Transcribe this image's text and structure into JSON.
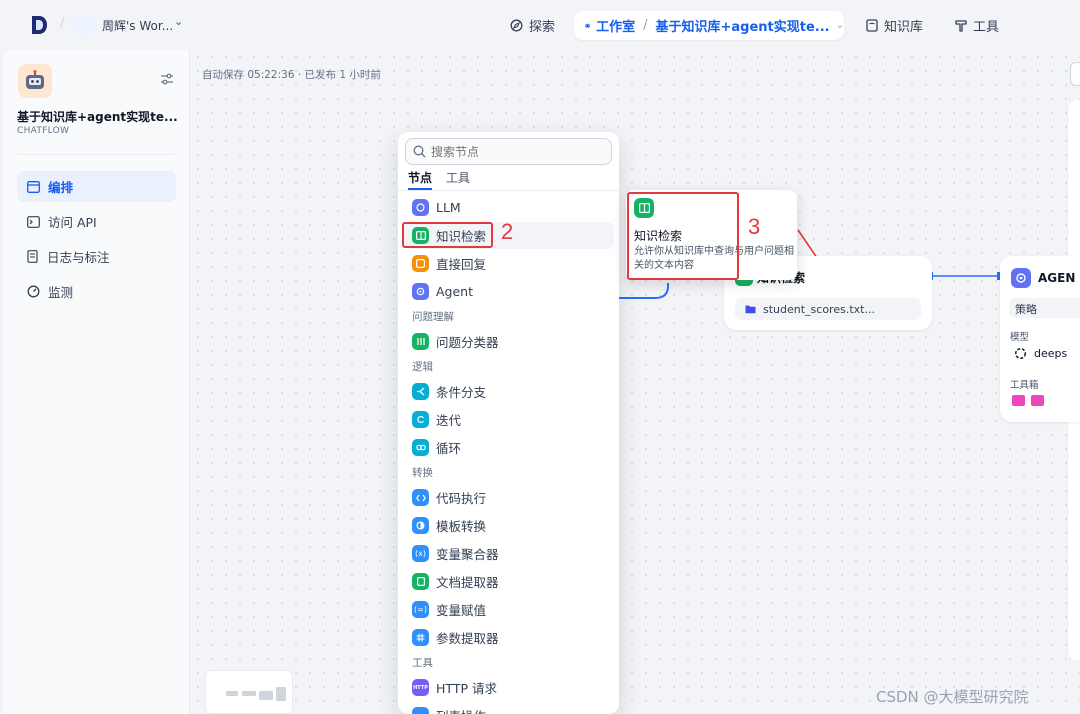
{
  "topbar": {
    "workspace_name": "周辉's Wor...",
    "nav": {
      "explore": "探索",
      "studio": "工作室",
      "app_name": "基于知识库+agent实现te...",
      "knowledge": "知识库",
      "tools": "工具"
    }
  },
  "sidebar": {
    "app_title": "基于知识库+agent实现te...",
    "app_type": "CHATFLOW",
    "items": [
      {
        "label": "编排",
        "icon": "layout-icon",
        "active": true
      },
      {
        "label": "访问 API",
        "icon": "terminal-icon",
        "active": false
      },
      {
        "label": "日志与标注",
        "icon": "document-icon",
        "active": false
      },
      {
        "label": "监测",
        "icon": "gauge-icon",
        "active": false
      }
    ]
  },
  "canvas": {
    "autosave": "自动保存 05:22:36 · 已发布 1 小时前",
    "kb_node": {
      "title": "知识检索",
      "file": "student_scores.txt..."
    },
    "agent_node": {
      "title": "AGEN",
      "strategy": "策略",
      "model_label": "模型",
      "model": "deeps",
      "toolbox_label": "工具箱"
    }
  },
  "picker": {
    "search_placeholder": "搜索节点",
    "tabs": [
      "节点",
      "工具"
    ],
    "items_top": [
      {
        "label": "LLM",
        "color": "#6172f3"
      },
      {
        "label": "知识检索",
        "color": "#16b364"
      },
      {
        "label": "直接回复",
        "color": "#f79009"
      },
      {
        "label": "Agent",
        "color": "#6172f3"
      }
    ],
    "cat_understanding": "问题理解",
    "items_understanding": [
      {
        "label": "问题分类器",
        "color": "#16b364"
      }
    ],
    "cat_logic": "逻辑",
    "items_logic": [
      {
        "label": "条件分支",
        "color": "#06aed4"
      },
      {
        "label": "迭代",
        "color": "#06aed4"
      },
      {
        "label": "循环",
        "color": "#06aed4"
      }
    ],
    "cat_transform": "转换",
    "items_transform": [
      {
        "label": "代码执行",
        "color": "#2e90fa"
      },
      {
        "label": "模板转换",
        "color": "#2e90fa"
      },
      {
        "label": "变量聚合器",
        "color": "#2e90fa"
      },
      {
        "label": "文档提取器",
        "color": "#16b364"
      },
      {
        "label": "变量赋值",
        "color": "#2e90fa"
      },
      {
        "label": "参数提取器",
        "color": "#2e90fa"
      }
    ],
    "cat_tools": "工具",
    "items_tools": [
      {
        "label": "HTTP 请求",
        "color": "#7a5af8"
      },
      {
        "label": "列表操作",
        "color": "#2e90fa"
      }
    ]
  },
  "tooltip": {
    "title": "知识检索",
    "desc": "允许你从知识库中查询与用户问题相关的文本内容"
  },
  "annotations": {
    "step2": "2",
    "step3": "3"
  },
  "watermark": "CSDN @大模型研究院"
}
